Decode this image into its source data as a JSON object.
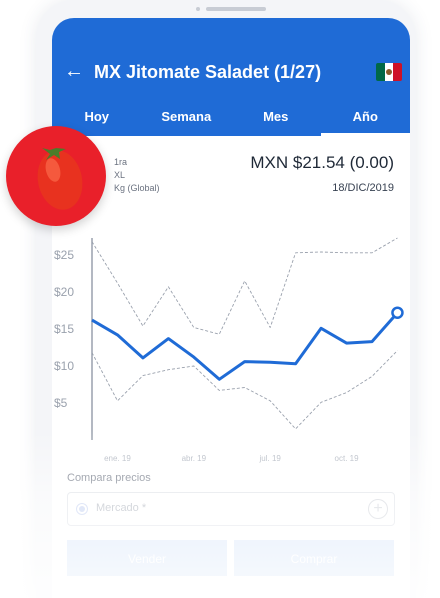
{
  "header": {
    "back_icon": "arrow-left-icon",
    "title": "MX Jitomate Saladet (1/27)",
    "flag_icon": "mexico-flag-icon",
    "color": "#1f6bd6"
  },
  "tabs": [
    {
      "label": "Hoy",
      "active": false
    },
    {
      "label": "Semana",
      "active": false
    },
    {
      "label": "Mes",
      "active": false
    },
    {
      "label": "Año",
      "active": true
    }
  ],
  "product": {
    "image_icon": "tomato-icon",
    "grade_lines": [
      "1ra",
      "XL",
      "Kg (Global)"
    ],
    "price": "MXN $21.54 (0.00)",
    "date": "18/DIC/2019"
  },
  "chart_data": {
    "type": "line",
    "y_tick_labels": [
      "$25",
      "$20",
      "$15",
      "$10",
      "$5"
    ],
    "y_ticks": [
      25,
      20,
      15,
      10,
      5
    ],
    "ylim": [
      0,
      30
    ],
    "x_tick_labels": [
      "ene. 19",
      "abr. 19",
      "jul. 19",
      "oct. 19"
    ],
    "x_ticks": [
      1,
      4,
      7,
      10
    ],
    "xlim": [
      0,
      12.1
    ],
    "x": [
      0,
      1,
      2,
      3,
      4,
      5,
      6,
      7,
      8,
      9,
      10,
      11,
      12
    ],
    "series": [
      {
        "style": "solid",
        "color": "#1f6bd6",
        "values": [
          16.2,
          14.2,
          11.1,
          13.7,
          11.2,
          8.2,
          10.6,
          10.5,
          10.3,
          15.1,
          13.1,
          13.3,
          17.2
        ]
      },
      {
        "style": "dashed",
        "color": "#9aa1ad",
        "values": [
          26.8,
          21.2,
          15.4,
          20.7,
          15.2,
          14.3,
          21.5,
          15.2,
          25.3,
          25.4,
          25.3,
          25.3,
          27.3
        ]
      },
      {
        "style": "dashed",
        "color": "#9aa1ad",
        "values": [
          11.8,
          5.3,
          8.7,
          9.5,
          10.0,
          6.7,
          7.1,
          5.3,
          1.5,
          5.1,
          6.4,
          8.6,
          12.1
        ]
      }
    ]
  },
  "compare": {
    "label": "Compara precios",
    "field_label": "Mercado *",
    "add_icon": "plus-circle-icon"
  },
  "actions": {
    "sell": "Vender",
    "buy": "Comprar"
  }
}
